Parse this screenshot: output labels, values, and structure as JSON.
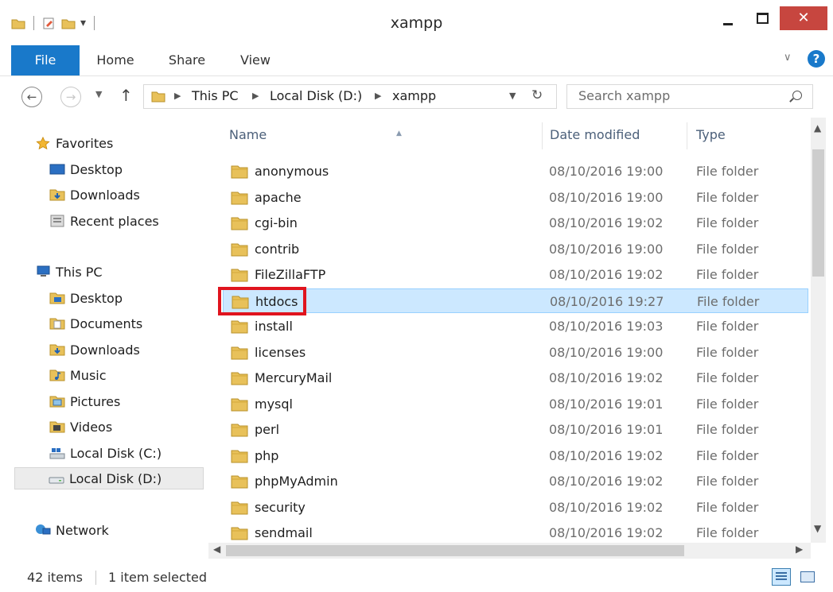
{
  "window": {
    "title": "xampp",
    "close_glyph": "✕"
  },
  "ribbon": {
    "tabs": [
      "File",
      "Home",
      "Share",
      "View"
    ],
    "help_glyph": "?"
  },
  "address": {
    "crumbs": [
      "This PC",
      "Local Disk (D:)",
      "xampp"
    ],
    "search_placeholder": "Search xampp"
  },
  "nav": {
    "favorites": {
      "label": "Favorites",
      "items": [
        "Desktop",
        "Downloads",
        "Recent places"
      ]
    },
    "this_pc": {
      "label": "This PC",
      "items": [
        "Desktop",
        "Documents",
        "Downloads",
        "Music",
        "Pictures",
        "Videos",
        "Local Disk (C:)",
        "Local Disk (D:)"
      ]
    },
    "network": {
      "label": "Network"
    }
  },
  "columns": {
    "name": "Name",
    "date": "Date modified",
    "type": "Type"
  },
  "files": [
    {
      "name": "anonymous",
      "date": "08/10/2016 19:00",
      "type": "File folder"
    },
    {
      "name": "apache",
      "date": "08/10/2016 19:00",
      "type": "File folder"
    },
    {
      "name": "cgi-bin",
      "date": "08/10/2016 19:02",
      "type": "File folder"
    },
    {
      "name": "contrib",
      "date": "08/10/2016 19:00",
      "type": "File folder"
    },
    {
      "name": "FileZillaFTP",
      "date": "08/10/2016 19:02",
      "type": "File folder"
    },
    {
      "name": "htdocs",
      "date": "08/10/2016 19:27",
      "type": "File folder",
      "selected": true
    },
    {
      "name": "install",
      "date": "08/10/2016 19:03",
      "type": "File folder"
    },
    {
      "name": "licenses",
      "date": "08/10/2016 19:00",
      "type": "File folder"
    },
    {
      "name": "MercuryMail",
      "date": "08/10/2016 19:02",
      "type": "File folder"
    },
    {
      "name": "mysql",
      "date": "08/10/2016 19:01",
      "type": "File folder"
    },
    {
      "name": "perl",
      "date": "08/10/2016 19:01",
      "type": "File folder"
    },
    {
      "name": "php",
      "date": "08/10/2016 19:02",
      "type": "File folder"
    },
    {
      "name": "phpMyAdmin",
      "date": "08/10/2016 19:02",
      "type": "File folder"
    },
    {
      "name": "security",
      "date": "08/10/2016 19:02",
      "type": "File folder"
    },
    {
      "name": "sendmail",
      "date": "08/10/2016 19:02",
      "type": "File folder"
    }
  ],
  "status": {
    "count": "42 items",
    "selected": "1 item selected"
  },
  "colors": {
    "accent": "#1979ca",
    "selection": "#cce8ff",
    "highlight_box": "#e0141e",
    "folder": "#e8c15a"
  }
}
